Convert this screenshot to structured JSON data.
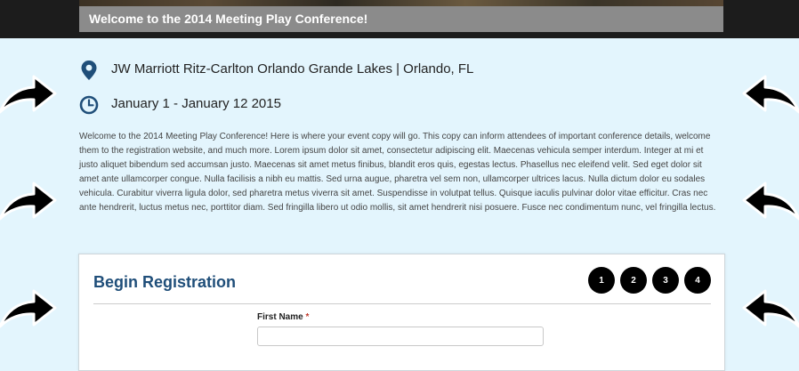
{
  "header": {
    "banner_title": "Welcome to the 2014 Meeting Play Conference!"
  },
  "event": {
    "location": "JW Marriott Ritz-Carlton Orlando Grande Lakes | Orlando, FL",
    "location_icon": "map-pin-icon",
    "dates": "January 1 - January 12 2015",
    "dates_icon": "clock-icon",
    "description": "Welcome to the 2014 Meeting Play Conference! Here is where your event copy will go. This copy can inform attendees of important conference details, welcome them to the registration website, and much more. Lorem ipsum dolor sit amet, consectetur adipiscing elit. Maecenas vehicula semper interdum. Integer at mi et justo aliquet bibendum sed accumsan justo. Maecenas sit amet metus finibus, blandit eros quis, egestas lectus. Phasellus nec eleifend velit. Sed eget dolor sit amet ante ullamcorper congue. Nulla facilisis a nibh eu mattis. Sed urna augue, pharetra vel sem non, ullamcorper ultrices lacus. Nulla dictum dolor eu sodales vehicula. Curabitur viverra ligula dolor, sed pharetra metus viverra sit amet. Suspendisse in volutpat tellus. Quisque iaculis pulvinar dolor vitae efficitur. Cras nec ante hendrerit, luctus metus nec, porttitor diam. Sed fringilla libero ut odio mollis, sit amet hendrerit nisi posuere. Fusce nec condimentum nunc, vel fringilla lectus."
  },
  "registration": {
    "title": "Begin Registration",
    "steps": [
      "1",
      "2",
      "3",
      "4"
    ],
    "first_name_label": "First Name",
    "required_mark": "*",
    "first_name_value": ""
  },
  "colors": {
    "page_background": "#e3f5fd",
    "accent": "#1f4e79",
    "banner": "#8b8b8b"
  }
}
